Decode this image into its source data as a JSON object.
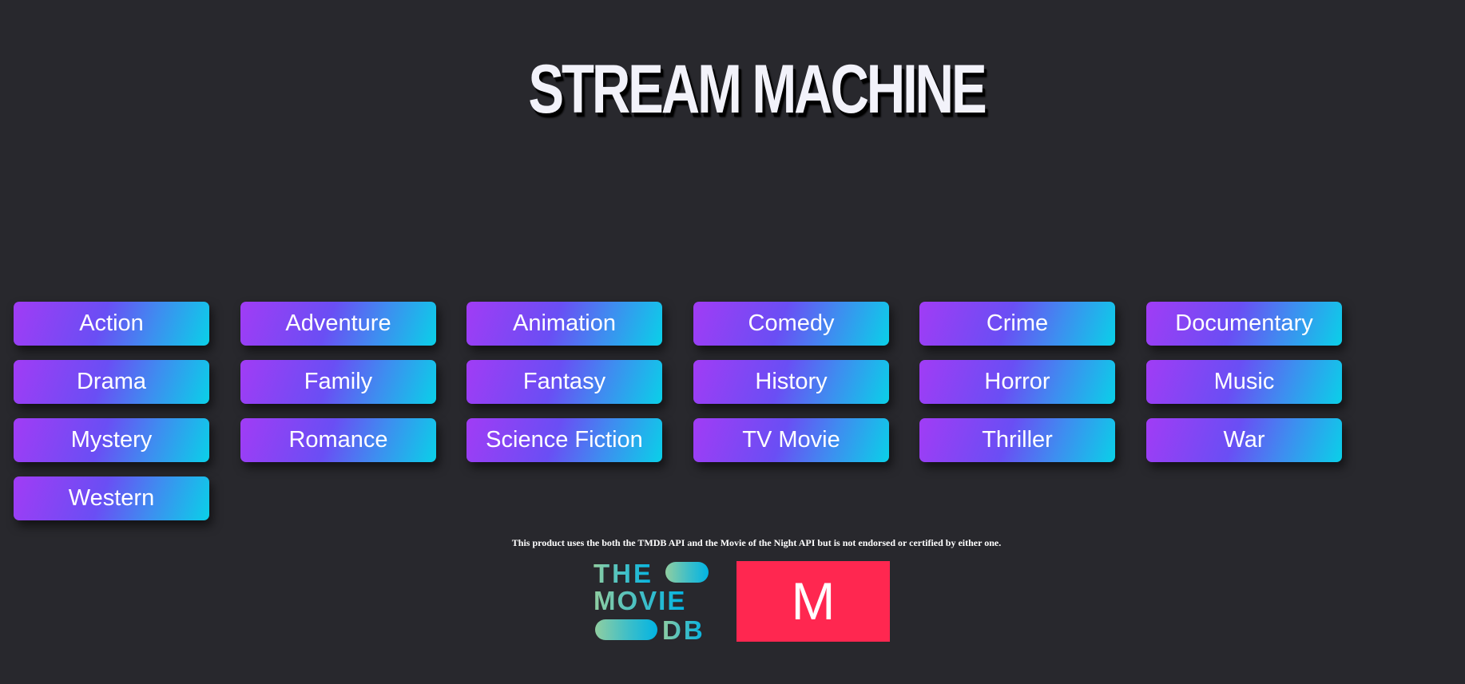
{
  "app": {
    "title": "STREAM MACHINE"
  },
  "genres": [
    "Action",
    "Adventure",
    "Animation",
    "Comedy",
    "Crime",
    "Documentary",
    "Drama",
    "Family",
    "Fantasy",
    "History",
    "Horror",
    "Music",
    "Mystery",
    "Romance",
    "Science Fiction",
    "TV Movie",
    "Thriller",
    "War",
    "Western"
  ],
  "footer": {
    "attribution": "This product uses the both the TMDB API and the Movie of the Night API but is not endorsed or certified by either one.",
    "tmdb_logo": {
      "line1": "THE",
      "line2": "MOVIE",
      "line3": "DB"
    },
    "motn_logo": {
      "letter": "M"
    }
  },
  "colors": {
    "background": "#28282d",
    "button_gradient_start": "#a13cf5",
    "button_gradient_end": "#0ad0e8",
    "motn_red": "#ff2750",
    "tmdb_green": "#90cea1",
    "tmdb_blue": "#01b4e4"
  }
}
